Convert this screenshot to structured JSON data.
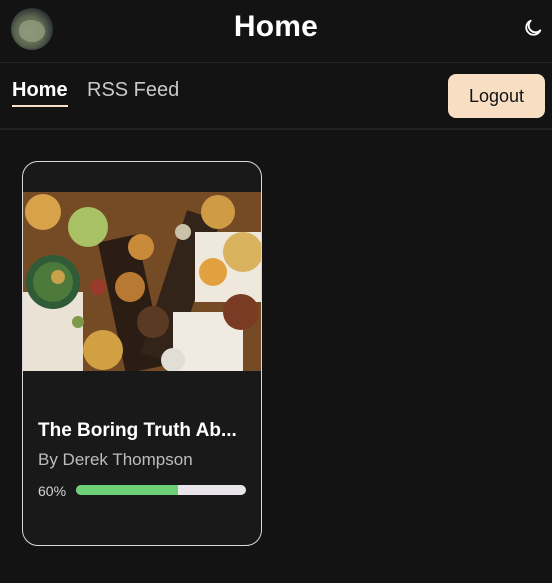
{
  "header": {
    "title": "Home",
    "avatar_icon": "user-avatar",
    "theme_icon": "moon-icon"
  },
  "nav": {
    "tabs": [
      {
        "label": "Home",
        "active": true
      },
      {
        "label": "RSS Feed",
        "active": false
      }
    ],
    "logout_label": "Logout"
  },
  "books": [
    {
      "title": "The Boring Truth Ab...",
      "author": "By Derek Thompson",
      "progress_label": "60%",
      "progress": 0.6
    }
  ],
  "colors": {
    "background": "#141314",
    "accent": "#f8dfc4",
    "progress": "#6dcf76"
  }
}
